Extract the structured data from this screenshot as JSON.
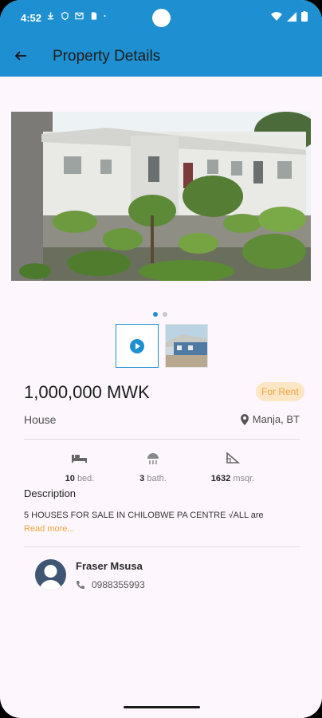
{
  "status_bar": {
    "time": "4:52",
    "icons": [
      "download-icon",
      "shield-icon",
      "gmail-icon",
      "sim-icon",
      "dot-icon"
    ],
    "right_icons": [
      "wifi-icon",
      "signal-icon",
      "battery-icon"
    ]
  },
  "app_bar": {
    "title": "Property Details",
    "back_icon": "arrow-back-icon"
  },
  "gallery": {
    "slide_count": 2,
    "active_slide": 0,
    "video_icon": "play-circle-icon"
  },
  "listing": {
    "price": "1,000,000 MWK",
    "status_badge": "For Rent",
    "type": "House",
    "location": "Manja, BT",
    "features": [
      {
        "icon": "bed-icon",
        "value": "10",
        "unit": "bed."
      },
      {
        "icon": "shower-icon",
        "value": "3",
        "unit": "bath."
      },
      {
        "icon": "area-icon",
        "value": "1632",
        "unit": "msqr."
      }
    ],
    "description_heading": "Description",
    "description_text": "5 HOUSES FOR SALE IN CHILOBWE PA CENTRE √ALL are",
    "read_more": "Read more..."
  },
  "agent": {
    "name": "Fraser Msusa",
    "phone": "0988355993"
  },
  "colors": {
    "primary": "#1e8fd0",
    "accent": "#f0a43b",
    "badge_bg": "#fde6c6",
    "background": "#fdf7fd"
  }
}
